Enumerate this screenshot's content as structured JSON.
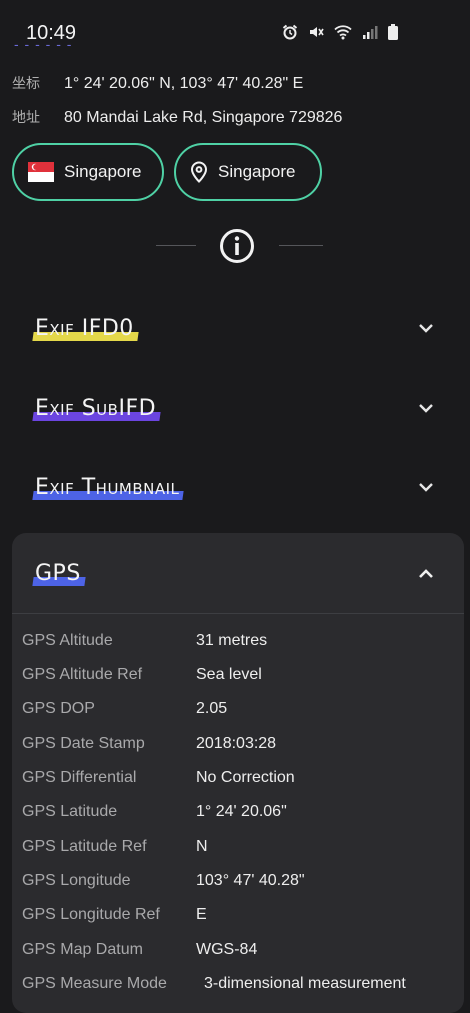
{
  "status_bar": {
    "time": "10:49",
    "icons": [
      "alarm-icon",
      "mute-icon",
      "wifi-icon",
      "signal-icon",
      "battery-icon"
    ]
  },
  "location": {
    "coords_label": "坐标",
    "coords_value": "1° 24' 20.06\" N, 103° 47' 40.28\" E",
    "address_label": "地址",
    "address_value": "80 Mandai Lake Rd, Singapore 729826"
  },
  "chips": [
    {
      "label": "Singapore",
      "icon": "flag-icon"
    },
    {
      "label": "Singapore",
      "icon": "location-pin-icon"
    }
  ],
  "sections": [
    {
      "title": "Exif IFD0",
      "expanded": false,
      "highlight": "#e4d84a"
    },
    {
      "title": "Exif SubIFD",
      "expanded": false,
      "highlight": "#6b45e0"
    },
    {
      "title": "Exif Thumbnail",
      "expanded": false,
      "highlight": "#4d63e6"
    }
  ],
  "gps": {
    "title": "GPS",
    "expanded": true,
    "highlight": "#4d63e6",
    "rows": [
      {
        "key": "GPS Altitude",
        "value": "31 metres"
      },
      {
        "key": "GPS Altitude Ref",
        "value": "Sea level"
      },
      {
        "key": "GPS DOP",
        "value": "2.05"
      },
      {
        "key": "GPS Date Stamp",
        "value": "2018:03:28"
      },
      {
        "key": "GPS Differential",
        "value": "No Correction"
      },
      {
        "key": "GPS Latitude",
        "value": "1° 24' 20.06\""
      },
      {
        "key": "GPS Latitude Ref",
        "value": "N"
      },
      {
        "key": "GPS Longitude",
        "value": "103° 47' 40.28\""
      },
      {
        "key": "GPS Longitude Ref",
        "value": "E"
      },
      {
        "key": "GPS Map Datum",
        "value": "WGS-84"
      },
      {
        "key": "GPS Measure Mode",
        "value": "3-dimensional measurement"
      }
    ]
  },
  "colors": {
    "background": "#1a1a1c",
    "chip_border": "#4fd1a5",
    "panel": "#2b2b2e"
  }
}
